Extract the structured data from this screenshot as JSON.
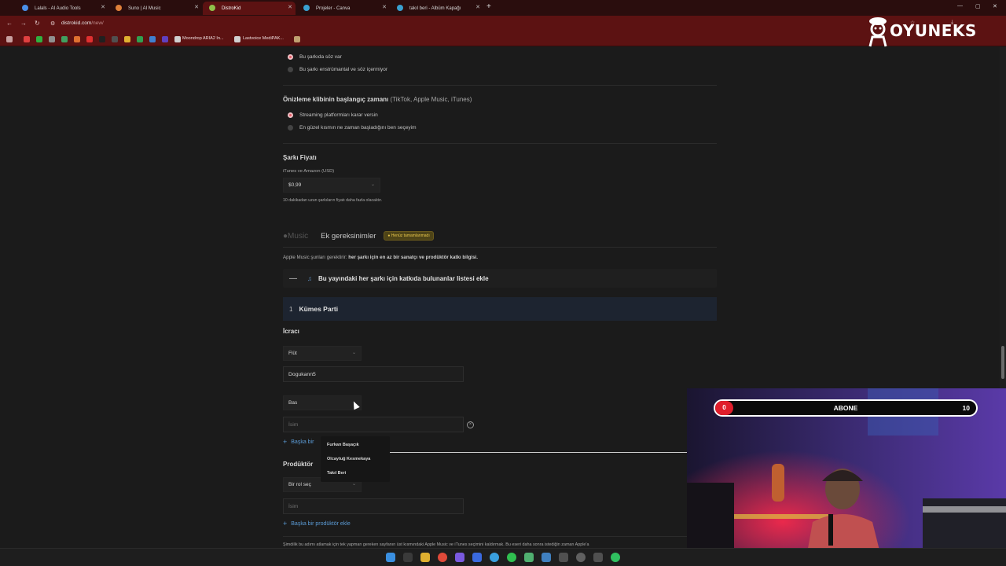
{
  "browser": {
    "tabs": [
      {
        "label": "Lalals - AI Audio Tools",
        "color": "#4a8fe8"
      },
      {
        "label": "Suno | AI Music",
        "color": "#e0803a"
      },
      {
        "label": "DistroKid",
        "color": "#8fbf4a",
        "active": true
      },
      {
        "label": "Projeler - Canva",
        "color": "#3aa0d0"
      },
      {
        "label": "takıl beri - Albüm Kapağı",
        "color": "#3aa0d0"
      }
    ],
    "url_host": "distrokid.com",
    "url_path": "/new/",
    "bookmarks": [
      "Moondrop ARIA2 In...",
      "Lastvoice MediPAK..."
    ]
  },
  "overlay": {
    "brand": "OYUNEKS",
    "subscriber_goal": {
      "title": "ABONE",
      "current": "0",
      "target": "10",
      "progress_fraction": 0
    }
  },
  "form": {
    "lyrics_opt1": "Bu şarkıda söz var",
    "lyrics_opt2": "Bu şarkı enstrümantal ve söz içermiyor",
    "preview_title": "Önizleme klibinin başlangıç zamanı",
    "preview_hint": "(TikTok, Apple Music, iTunes)",
    "preview_opt1": "Streaming platformları karar versin",
    "preview_opt2": "En güzel kısmın ne zaman başladığını ben seçeyim",
    "price_title": "Şarkı Fiyatı",
    "price_label": "iTunes ve Amazon (USD)",
    "price_value": "$0,99",
    "price_note": "10 dakikadan uzun şarkıların fiyatı daha fazla olacaktır.",
    "apple_logo": "Music",
    "extra_tab": "Ek gereksinimler",
    "badge": "Henüz tamamlanmadı",
    "apple_note_prefix": "Apple Music şunları gerektirir:",
    "apple_note_bold": "her şarkı için en az bir sanatçı ve prodüktör katkı bilgisi.",
    "accordion_title": "Bu yayındaki her şarkı için katkıda bulunanlar listesi ekle",
    "song_number": "1",
    "song_title": "Kümes Parti",
    "performer_title": "İcracı",
    "role1": "Flüt",
    "name1": "Dogukann5",
    "role2": "Bas",
    "name2_placeholder": "İsim",
    "add_performer": "Başka bir",
    "producer_title": "Prodüktör",
    "producer_role": "Bir rol seç",
    "producer_name_placeholder": "İsim",
    "add_producer": "Başka bir prodüktör ekle",
    "footer_text": "Şimdilik bu adımı atlamak için tek yapman gereken sayfanın üst kısmındaki Apple Music ve iTunes seçimini kaldırmak. Bu eseri daha sonra istediğin zaman Apple'a"
  },
  "dropdown_items": [
    "Furkan Başaçık",
    "Olcaytuğ Kesmekaya",
    "Takıl Beri"
  ]
}
